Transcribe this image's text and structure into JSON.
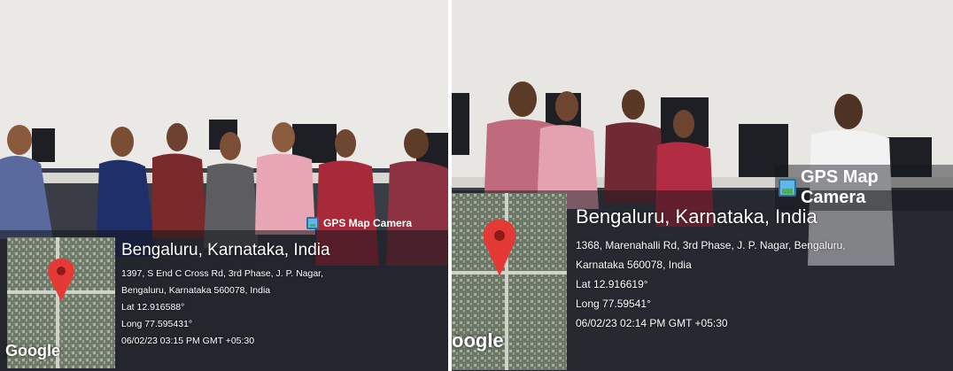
{
  "photos": [
    {
      "badge": "GPS Map Camera",
      "location_title": "Bengaluru, Karnataka, India",
      "address_line1": "1397, S End C Cross Rd, 3rd Phase, J. P. Nagar,",
      "address_line2": "Bengaluru, Karnataka 560078, India",
      "lat": "Lat 12.916588°",
      "long": "Long 77.595431°",
      "timestamp": "06/02/23 03:15 PM GMT +05:30",
      "map_brand": "Google"
    },
    {
      "badge": "GPS Map Camera",
      "location_title": "Bengaluru, Karnataka, India",
      "address_line1": "1368, Marenahalli Rd, 3rd Phase, J. P. Nagar, Bengaluru,",
      "address_line2": "Karnataka 560078, India",
      "lat": "Lat 12.916619°",
      "long": "Long 77.59541°",
      "timestamp": "06/02/23 02:14 PM GMT +05:30",
      "map_brand": "oogle"
    }
  ],
  "colors": {
    "pin": "#e53935",
    "overlay_text": "#ffffff",
    "badge_icon": "#5fb8e6"
  }
}
